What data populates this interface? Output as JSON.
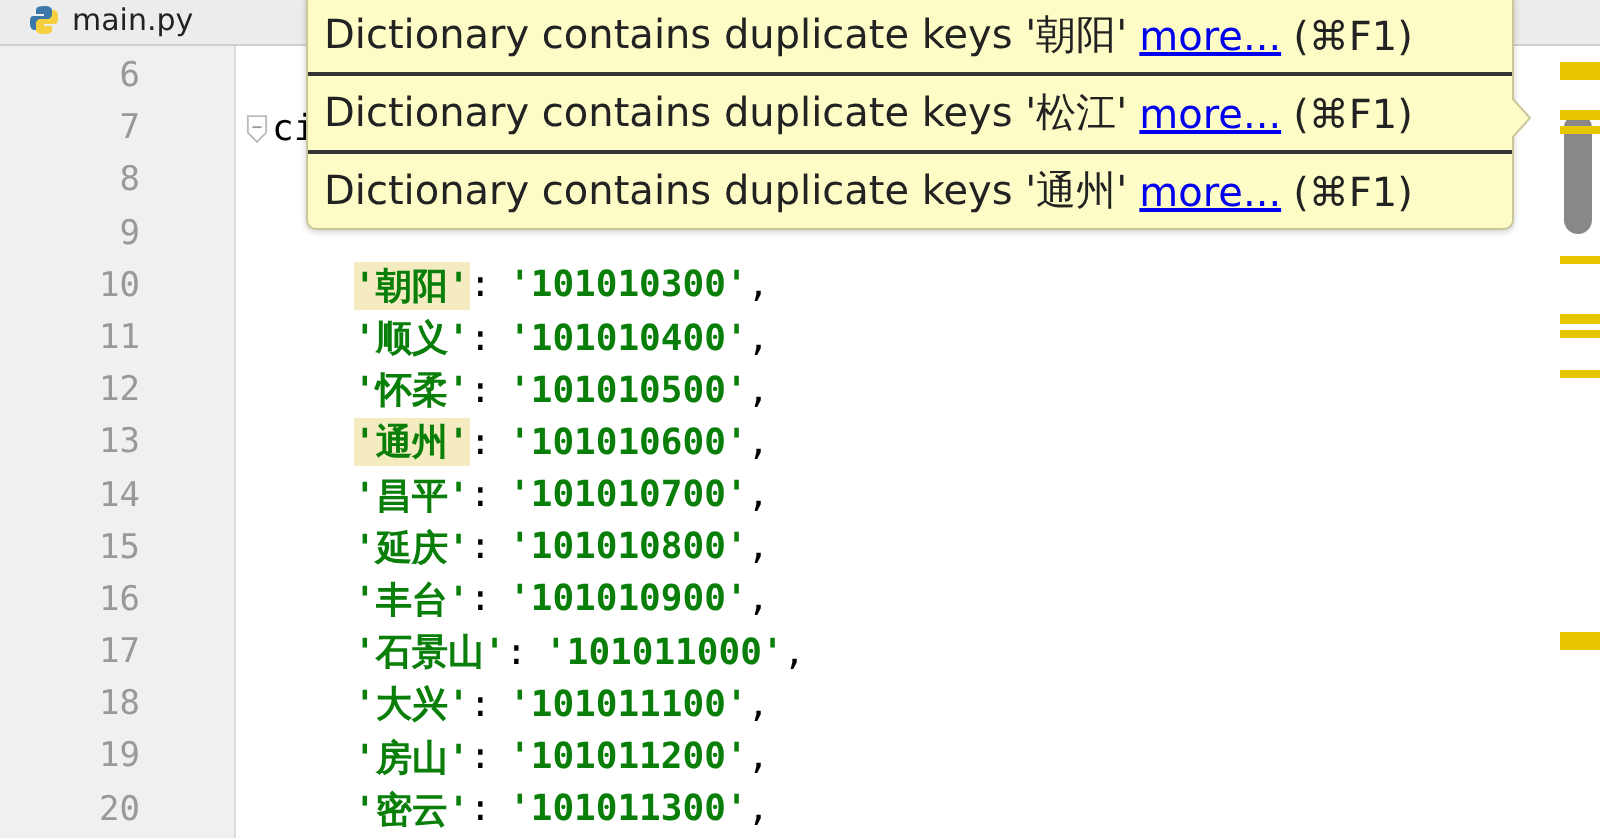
{
  "tab": {
    "label": "main.py"
  },
  "lines": [
    {
      "number": "6"
    },
    {
      "number": "7",
      "kind": "code",
      "code": "ci",
      "fold": true
    },
    {
      "number": "8"
    },
    {
      "number": "9"
    },
    {
      "number": "10",
      "kind": "pair",
      "key": "'朝阳'",
      "colon": ":",
      "value": "'101010300'",
      "comma": ",",
      "highlighted": true
    },
    {
      "number": "11",
      "kind": "pair",
      "key": "'顺义'",
      "colon": ":",
      "value": "'101010400'",
      "comma": ",",
      "highlighted": false
    },
    {
      "number": "12",
      "kind": "pair",
      "key": "'怀柔'",
      "colon": ":",
      "value": "'101010500'",
      "comma": ",",
      "highlighted": false
    },
    {
      "number": "13",
      "kind": "pair",
      "key": "'通州'",
      "colon": ":",
      "value": "'101010600'",
      "comma": ",",
      "highlighted": true
    },
    {
      "number": "14",
      "kind": "pair",
      "key": "'昌平'",
      "colon": ":",
      "value": "'101010700'",
      "comma": ",",
      "highlighted": false
    },
    {
      "number": "15",
      "kind": "pair",
      "key": "'延庆'",
      "colon": ":",
      "value": "'101010800'",
      "comma": ",",
      "highlighted": false
    },
    {
      "number": "16",
      "kind": "pair",
      "key": "'丰台'",
      "colon": ":",
      "value": "'101010900'",
      "comma": ",",
      "highlighted": false
    },
    {
      "number": "17",
      "kind": "pair",
      "key": "'石景山'",
      "colon": ":",
      "value": "'101011000'",
      "comma": ",",
      "highlighted": false
    },
    {
      "number": "18",
      "kind": "pair",
      "key": "'大兴'",
      "colon": ":",
      "value": "'101011100'",
      "comma": ",",
      "highlighted": false
    },
    {
      "number": "19",
      "kind": "pair",
      "key": "'房山'",
      "colon": ":",
      "value": "'101011200'",
      "comma": ",",
      "highlighted": false
    },
    {
      "number": "20",
      "kind": "pair",
      "key": "'密云'",
      "colon": ":",
      "value": "'101011300'",
      "comma": ",",
      "highlighted": false
    }
  ],
  "tooltip": {
    "messages": [
      {
        "text": "Dictionary contains duplicate keys '朝阳'",
        "link": "more...",
        "shortcut": "(⌘F1)"
      },
      {
        "text": "Dictionary contains duplicate keys '松江'",
        "link": "more...",
        "shortcut": "(⌘F1)"
      },
      {
        "text": "Dictionary contains duplicate keys '通州'",
        "link": "more...",
        "shortcut": "(⌘F1)"
      }
    ]
  }
}
